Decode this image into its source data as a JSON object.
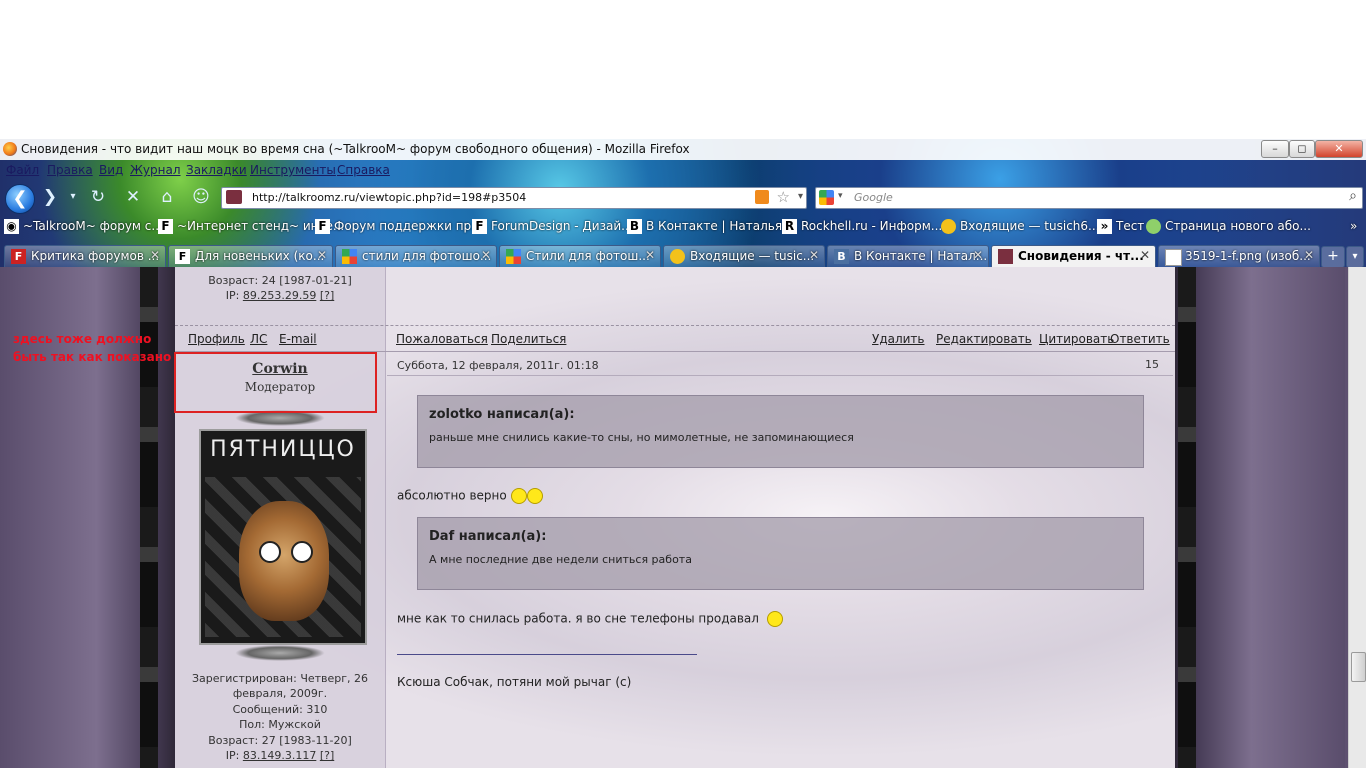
{
  "window": {
    "title": "Сновидения - что видит наш моцк во время сна (~TalkrooM~ форум свободного общения) - Mozilla Firefox"
  },
  "menu": [
    "Файл",
    "Правка",
    "Вид",
    "Журнал",
    "Закладки",
    "Инструменты",
    "Справка"
  ],
  "nav": {
    "url": "http://talkroomz.ru/viewtopic.php?id=198#p3504",
    "search_placeholder": "Google"
  },
  "bookmarks": [
    {
      "label": "~TalkrooM~ форум с...",
      "icon": "forum-icon"
    },
    {
      "label": "~Интернет стенд~ инте...",
      "icon": "forum-icon"
    },
    {
      "label": "Форум поддержки пр...",
      "icon": "forum-icon"
    },
    {
      "label": "ForumDesign - Дизай...",
      "icon": "forum-icon"
    },
    {
      "label": "В Контакте | Наталья ...",
      "icon": "vk-icon"
    },
    {
      "label": "Rockhell.ru - Информ...",
      "icon": "rockhell-icon"
    },
    {
      "label": "Входящие — tusich6...",
      "icon": "mail-icon"
    },
    {
      "label": "Тест",
      "icon": "test-icon"
    },
    {
      "label": "Страница нового або...",
      "icon": "page-icon"
    }
  ],
  "tabs": [
    {
      "label": "Критика форумов ...",
      "icon": "F"
    },
    {
      "label": "Для новеньких (ко...",
      "icon": "F"
    },
    {
      "label": "стили для фотошо...",
      "icon": "G"
    },
    {
      "label": "Стили для фотош...",
      "icon": "G"
    },
    {
      "label": "Входящие — tusic...",
      "icon": "M"
    },
    {
      "label": "В Контакте | Натал...",
      "icon": "B"
    },
    {
      "label": "Сновидения - чт...",
      "icon": "S",
      "active": true
    },
    {
      "label": "3519-1-f.png (изоб...",
      "icon": "P"
    }
  ],
  "previous_post": {
    "age": "Возраст: 24 [1987-01-21]",
    "ip_label": "IP:",
    "ip": "89.253.29.59",
    "ip_q": "[?]",
    "actions_left": [
      "Профиль",
      "ЛС",
      "E-mail"
    ],
    "actions_mid": [
      "Пожаловаться",
      "Поделиться"
    ],
    "actions_right": [
      "Удалить",
      "Редактировать",
      "Цитировать",
      "Ответить"
    ]
  },
  "annotation": "здесь тоже должно быть так как показано",
  "post": {
    "author": "Corwin",
    "role": "Модератор",
    "avatar_caption": "ПЯТНИЦЦО",
    "date": "Суббота, 12 февраля, 2011г. 01:18",
    "number": "15",
    "quote1_author": "zolotko написал(а):",
    "quote1_text": "раньше мне снились какие-то сны, но мимолетные, не запоминающиеся",
    "text1": "абсолютно верно",
    "quote2_author": "Daf написал(а):",
    "quote2_text": "А мне последние две недели сниться работа",
    "text2": "мне как то снилась работа. я во сне телефоны продавал",
    "signature": "Ксюша Собчак, потяни мой рычаг (с)",
    "registered_1": "Зарегистрирован: Четверг, 26",
    "registered_2": "февраля, 2009г.",
    "messages": "Сообщений: 310",
    "gender": "Пол: Мужской",
    "age": "Возраст: 27 [1983-11-20]",
    "ip_label": "IP:",
    "ip": "83.149.3.117",
    "ip_q": "[?]"
  }
}
